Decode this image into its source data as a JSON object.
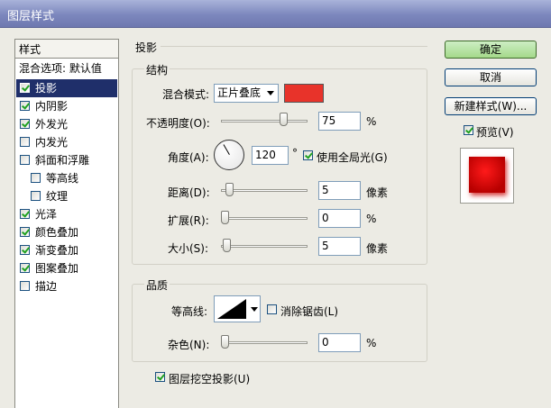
{
  "window": {
    "title": "图层样式"
  },
  "styles": {
    "header": "样式",
    "blend_options": "混合选项: 默认值",
    "items": [
      {
        "label": "投影",
        "checked": true,
        "selected": true,
        "sub": false
      },
      {
        "label": "内阴影",
        "checked": true,
        "selected": false,
        "sub": false
      },
      {
        "label": "外发光",
        "checked": true,
        "selected": false,
        "sub": false
      },
      {
        "label": "内发光",
        "checked": false,
        "selected": false,
        "sub": false
      },
      {
        "label": "斜面和浮雕",
        "checked": false,
        "selected": false,
        "sub": false
      },
      {
        "label": "等高线",
        "checked": false,
        "selected": false,
        "sub": true
      },
      {
        "label": "纹理",
        "checked": false,
        "selected": false,
        "sub": true
      },
      {
        "label": "光泽",
        "checked": true,
        "selected": false,
        "sub": false
      },
      {
        "label": "颜色叠加",
        "checked": true,
        "selected": false,
        "sub": false
      },
      {
        "label": "渐变叠加",
        "checked": true,
        "selected": false,
        "sub": false
      },
      {
        "label": "图案叠加",
        "checked": true,
        "selected": false,
        "sub": false
      },
      {
        "label": "描边",
        "checked": false,
        "selected": false,
        "sub": false
      }
    ]
  },
  "drop_shadow": {
    "section_title": "投影",
    "structure": {
      "title": "结构",
      "blend_mode_label": "混合模式:",
      "blend_mode_value": "正片叠底",
      "color": "#e8332a",
      "opacity_label": "不透明度(O):",
      "opacity_value": "75",
      "opacity_unit": "%",
      "opacity_level": 75,
      "angle_label": "角度(A):",
      "angle_value": "120",
      "angle_unit": "°",
      "global_light_label": "使用全局光(G)",
      "global_light_checked": true,
      "distance_label": "距离(D):",
      "distance_value": "5",
      "distance_unit": "像素",
      "spread_label": "扩展(R):",
      "spread_value": "0",
      "spread_unit": "%",
      "size_label": "大小(S):",
      "size_value": "5",
      "size_unit": "像素"
    },
    "quality": {
      "title": "品质",
      "contour_label": "等高线:",
      "antialias_label": "消除锯齿(L)",
      "antialias_checked": false,
      "noise_label": "杂色(N):",
      "noise_value": "0",
      "noise_unit": "%"
    },
    "knockout_label": "图层挖空投影(U)",
    "knockout_checked": true
  },
  "buttons": {
    "ok": "确定",
    "cancel": "取消",
    "new_style": "新建样式(W)...",
    "preview_label": "预览(V)",
    "preview_checked": true
  }
}
